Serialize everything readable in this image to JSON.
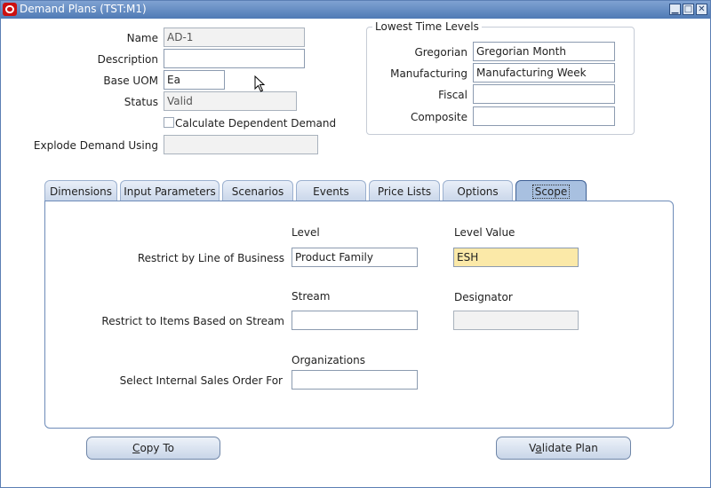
{
  "window": {
    "title": "Demand Plans (TST:M1)"
  },
  "header": {
    "name_label": "Name",
    "name_value": "AD-1",
    "description_label": "Description",
    "description_value": "",
    "base_uom_label": "Base UOM",
    "base_uom_value": "Ea",
    "status_label": "Status",
    "status_value": "Valid",
    "calc_dependent_label": "Calculate Dependent Demand",
    "explode_label": "Explode Demand Using",
    "explode_value": ""
  },
  "time_levels": {
    "title": "Lowest Time Levels",
    "gregorian_label": "Gregorian",
    "gregorian_value": "Gregorian Month",
    "manufacturing_label": "Manufacturing",
    "manufacturing_value": "Manufacturing Week",
    "fiscal_label": "Fiscal",
    "fiscal_value": "",
    "composite_label": "Composite",
    "composite_value": ""
  },
  "tabs": [
    {
      "label": "Dimensions"
    },
    {
      "label": "Input Parameters"
    },
    {
      "label": "Scenarios"
    },
    {
      "label": "Events"
    },
    {
      "label": "Price Lists"
    },
    {
      "label": "Options"
    },
    {
      "label": "Scope",
      "active": true
    }
  ],
  "scope": {
    "level_header": "Level",
    "level_value_header": "Level Value",
    "lob_label": "Restrict by Line of Business",
    "lob_level": "Product Family",
    "lob_level_value": "ESH",
    "stream_header": "Stream",
    "designator_header": "Designator",
    "stream_label": "Restrict to Items Based on Stream",
    "stream_value": "",
    "designator_value": "",
    "organizations_header": "Organizations",
    "iso_label": "Select Internal Sales Order For",
    "organizations_value": ""
  },
  "buttons": {
    "copy_to": {
      "mnemonic": "C",
      "rest": "opy To"
    },
    "validate": {
      "prefix": "V",
      "mnemonic": "a",
      "rest": "lidate Plan"
    }
  },
  "colors": {
    "titlebar": "#4f7ab5",
    "active_tab": "#a8c0e0",
    "highlight_field": "#fbe9a8"
  }
}
